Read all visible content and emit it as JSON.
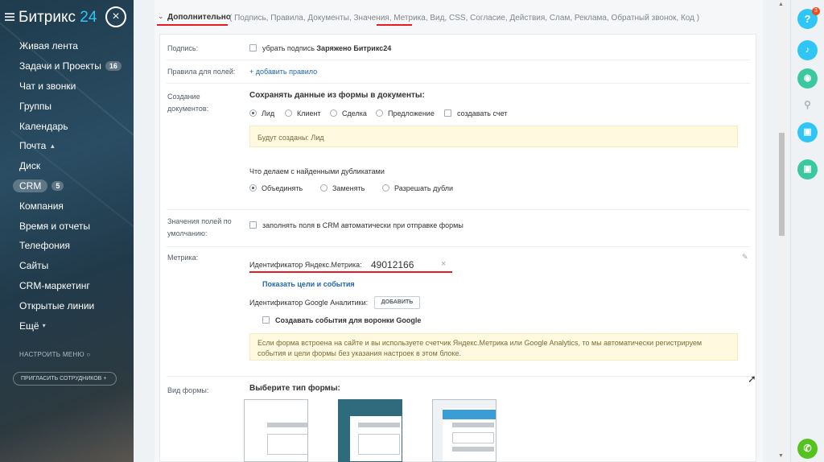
{
  "sidebar": {
    "logo": "Битрикс",
    "logo_num": "24",
    "close_glyph": "×",
    "items": [
      {
        "label": "Живая лента"
      },
      {
        "label": "Задачи и Проекты",
        "badge": "16"
      },
      {
        "label": "Чат и звонки"
      },
      {
        "label": "Группы"
      },
      {
        "label": "Календарь"
      },
      {
        "label": "Почта",
        "suffix": "▲"
      },
      {
        "label": "Диск"
      },
      {
        "label": "CRM",
        "badge": "5"
      },
      {
        "label": "Компания"
      },
      {
        "label": "Время и отчеты"
      },
      {
        "label": "Телефония"
      },
      {
        "label": "Сайты"
      },
      {
        "label": "CRM-маркетинг"
      },
      {
        "label": "Открытые линии"
      },
      {
        "label": "Ещё"
      }
    ],
    "settings": "НАСТРОИТЬ МЕНЮ",
    "invite": "ПРИГЛАСИТЬ СОТРУДНИКОВ"
  },
  "topbar": {
    "title": "Дополнительно",
    "items": "( Подпись, Правила, Документы, Значения, Метрика, Вид, CSS, Согласие, Действия, Слам, Реклама, Обратный звонок, Код )"
  },
  "form": {
    "signature": {
      "label": "Подпись:",
      "checkbox": "убрать подпись",
      "brand": "Заряжено Битрикс24"
    },
    "rules": {
      "label": "Правила для полей:",
      "link": "+ добавить правило"
    },
    "documents": {
      "label": "Создание документов:",
      "heading": "Сохранять данные из формы в документы:",
      "options": [
        "Лид",
        "Клиент",
        "Сделка",
        "Предложение"
      ],
      "invoice": "создавать счет",
      "note": "Будут созданы: Лид",
      "dup_heading": "Что делаем с найденными дубликатами",
      "dup_options": [
        "Объединять",
        "Заменять",
        "Разрешать дубли"
      ]
    },
    "defaults": {
      "label": "Значения полей по умолчанию:",
      "checkbox": "заполнять поля в CRM автоматически при отправке формы"
    },
    "metrika": {
      "label": "Метрика:",
      "yandex_label": "Идентификатор Яндекс.Метрика:",
      "yandex_value": "49012166",
      "goals_link": "Показать цели и события",
      "ga_label": "Идентификатор Google Аналитики:",
      "ga_button": "ДОБАВИТЬ",
      "ga_events": "Создавать события для воронки Google",
      "note": "Если форма встроена на сайте и вы используете счетчик Яндекс.Метрика или Google Analytics, то мы автоматически регистрируем события и цели формы без указания настроек в этом блоке."
    },
    "view": {
      "label": "Вид формы:",
      "heading": "Выберите тип формы:"
    }
  },
  "rightbar": {
    "help": "?",
    "help_counter": "3"
  },
  "colors": {
    "accent": "#2fc6f6",
    "underline": "#e51c23",
    "link": "#2067b0",
    "green": "#55d0a0",
    "blue": "#2fc6f6"
  }
}
